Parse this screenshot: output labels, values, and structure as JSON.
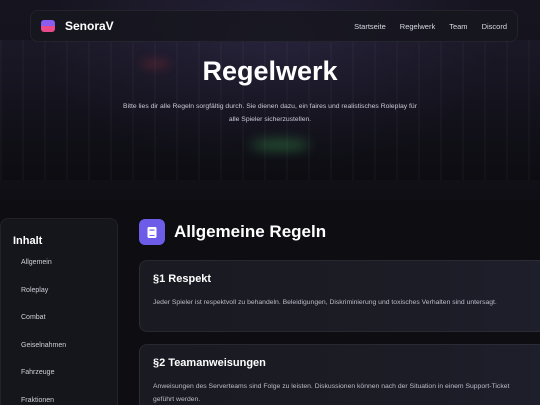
{
  "nav": {
    "brand": "SenoraV",
    "links": [
      "Startseite",
      "Regelwerk",
      "Team",
      "Discord"
    ]
  },
  "hero": {
    "title": "Regelwerk",
    "subtitle": "Bitte lies dir alle Regeln sorgfältig durch. Sie dienen dazu, ein faires und realistisches Roleplay für alle Spieler sicherzustellen."
  },
  "sidebar": {
    "title": "Inhalt",
    "items": [
      "Allgemein",
      "Roleplay",
      "Combat",
      "Geiselnahmen",
      "Fahrzeuge",
      "Fraktionen"
    ]
  },
  "section": {
    "icon": "book-icon",
    "title": "Allgemeine Regeln"
  },
  "rules": [
    {
      "title": "§1 Respekt",
      "text": "Jeder Spieler ist respektvoll zu behandeln. Beleidigungen, Diskriminierung und toxisches Verhalten sind untersagt."
    },
    {
      "title": "§2 Teamanweisungen",
      "text": "Anweisungen des Serverteams sind Folge zu leisten. Diskussionen können nach der Situation in einem Support-Ticket geführt werden."
    }
  ],
  "colors": {
    "accent": "#6c5ce7",
    "background": "#0d0d12",
    "card": "#1a1a22"
  }
}
